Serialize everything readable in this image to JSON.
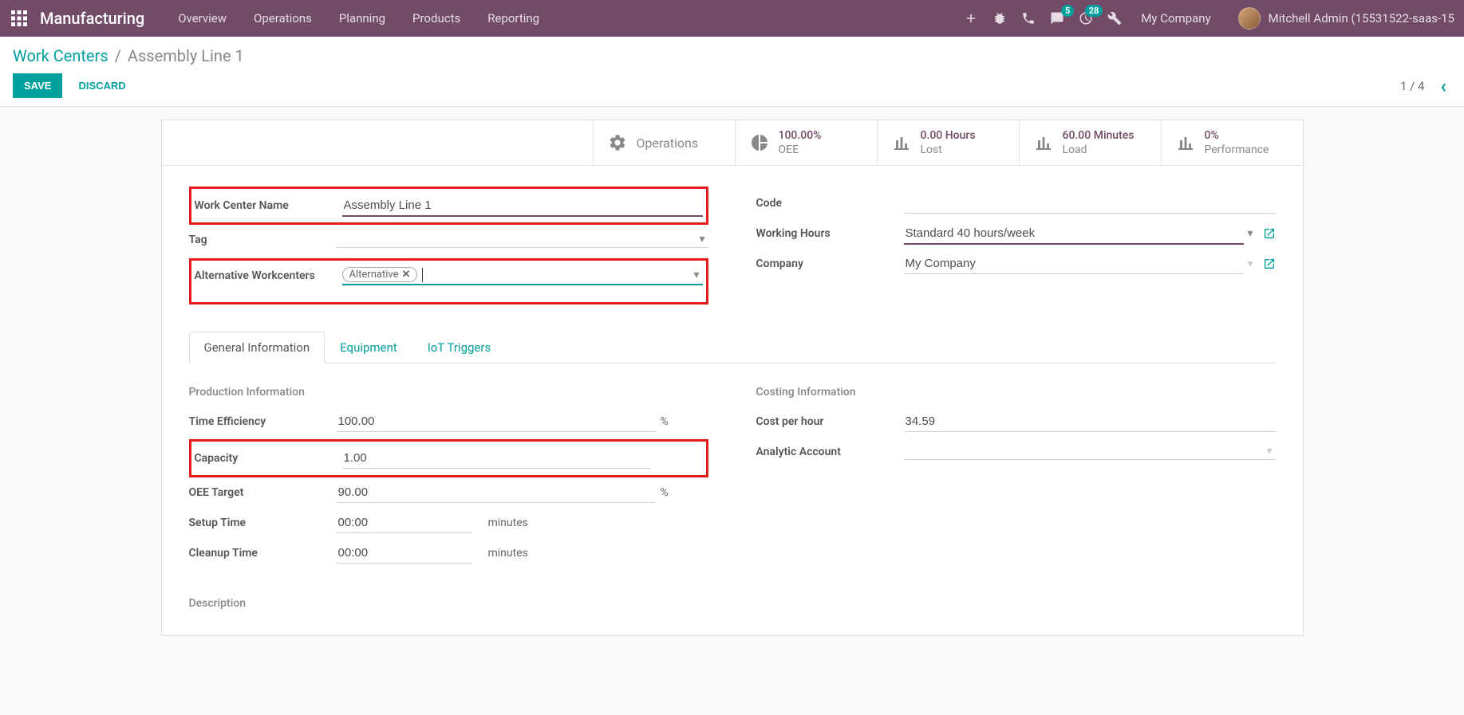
{
  "navbar": {
    "brand": "Manufacturing",
    "menu": [
      "Overview",
      "Operations",
      "Planning",
      "Products",
      "Reporting"
    ],
    "messages_badge": "5",
    "activities_badge": "28",
    "company": "My Company",
    "user": "Mitchell Admin (15531522-saas-15"
  },
  "breadcrumb": {
    "parent": "Work Centers",
    "current": "Assembly Line 1"
  },
  "buttons": {
    "save": "SAVE",
    "discard": "DISCARD"
  },
  "pager": "1 / 4",
  "stats": {
    "operations": "Operations",
    "oee_value": "100.00%",
    "oee_label": "OEE",
    "lost_value": "0.00 Hours",
    "lost_label": "Lost",
    "load_value": "60.00 Minutes",
    "load_label": "Load",
    "perf_value": "0%",
    "perf_label": "Performance"
  },
  "fields": {
    "name_label": "Work Center Name",
    "name_value": "Assembly Line 1",
    "tag_label": "Tag",
    "alt_label": "Alternative Workcenters",
    "alt_tag": "Alternative",
    "code_label": "Code",
    "hours_label": "Working Hours",
    "hours_value": "Standard 40 hours/week",
    "company_label": "Company",
    "company_value": "My Company"
  },
  "tabs": {
    "general": "General Information",
    "equipment": "Equipment",
    "iot": "IoT Triggers"
  },
  "general": {
    "prod_title": "Production Information",
    "time_eff_label": "Time Efficiency",
    "time_eff_value": "100.00",
    "capacity_label": "Capacity",
    "capacity_value": "1.00",
    "oee_target_label": "OEE Target",
    "oee_target_value": "90.00",
    "setup_label": "Setup Time",
    "setup_value": "00:00",
    "cleanup_label": "Cleanup Time",
    "cleanup_value": "00:00",
    "minutes": "minutes",
    "percent": "%",
    "cost_title": "Costing Information",
    "cost_hour_label": "Cost per hour",
    "cost_hour_value": "34.59",
    "analytic_label": "Analytic Account",
    "description_label": "Description"
  }
}
